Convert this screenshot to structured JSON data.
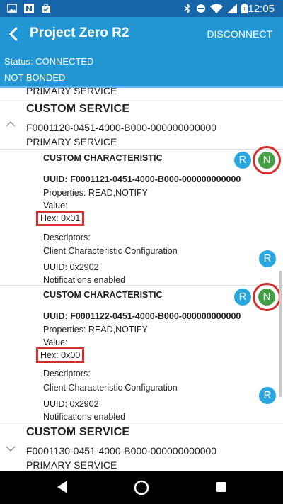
{
  "status_bar": {
    "time": "12:05",
    "left_icons": [
      "image-icon",
      "n-notification-icon",
      "briefcase-icon"
    ],
    "right_icons": [
      "bluetooth-icon",
      "do-not-disturb-icon",
      "wifi-icon",
      "signal-icon",
      "battery-icon"
    ]
  },
  "app_bar": {
    "title": "Project Zero R2",
    "action_label": "DISCONNECT"
  },
  "status_strip": {
    "status": "Status: CONNECTED",
    "bond": "NOT BONDED"
  },
  "content": {
    "partial_service_type": "PRIMARY SERVICE",
    "services": [
      {
        "title": "CUSTOM SERVICE",
        "uuid": "F0001120-0451-4000-B000-000000000000",
        "type": "PRIMARY SERVICE",
        "expanded": true,
        "characteristics": [
          {
            "title": "CUSTOM CHARACTERISTIC",
            "uuid": "UUID: F0001121-0451-4000-B000-000000000000",
            "properties": "Properties: READ,NOTIFY",
            "value_label": "Value:",
            "hex": "Hex: 0x01",
            "descriptors_label": "Descriptors:",
            "descriptor_name": "Client Characteristic Configuration",
            "descriptor_uuid": "UUID: 0x2902",
            "descriptor_status": "Notifications enabled",
            "read_btn": "R",
            "notify_btn": "N",
            "descriptor_read_btn": "R"
          },
          {
            "title": "CUSTOM CHARACTERISTIC",
            "uuid": "UUID: F0001122-0451-4000-B000-000000000000",
            "properties": "Properties: READ,NOTIFY",
            "value_label": "Value:",
            "hex": "Hex: 0x00",
            "descriptors_label": "Descriptors:",
            "descriptor_name": "Client Characteristic Configuration",
            "descriptor_uuid": "UUID: 0x2902",
            "descriptor_status": "Notifications enabled",
            "read_btn": "R",
            "notify_btn": "N",
            "descriptor_read_btn": "R"
          }
        ]
      },
      {
        "title": "CUSTOM SERVICE",
        "uuid": "F0001130-0451-4000-B000-000000000000",
        "type": "PRIMARY SERVICE",
        "expanded": false
      }
    ]
  },
  "nav_bar": {
    "buttons": [
      "back-nav-icon",
      "home-nav-icon",
      "recents-nav-icon"
    ]
  }
}
